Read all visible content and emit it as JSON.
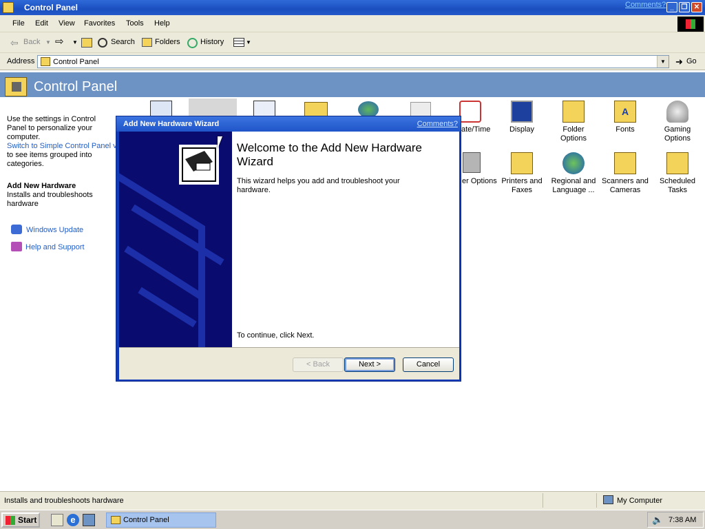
{
  "window": {
    "title": "Control Panel",
    "comments_link": "Comments?"
  },
  "menubar": {
    "items": [
      "File",
      "Edit",
      "View",
      "Favorites",
      "Tools",
      "Help"
    ]
  },
  "toolbar": {
    "back": "Back",
    "search": "Search",
    "folders": "Folders",
    "history": "History"
  },
  "address": {
    "label": "Address",
    "value": "Control Panel",
    "go": "Go"
  },
  "banner": {
    "title": "Control Panel"
  },
  "left_pane": {
    "intro": "Use the settings in Control Panel to personalize your computer.",
    "switch_link": "Switch to Simple Control Panel view",
    "switch_rest": "to see items grouped into categories.",
    "selected_title": "Add New Hardware",
    "selected_desc": "Installs and troubleshoots hardware",
    "links": [
      "Windows Update",
      "Help and Support"
    ]
  },
  "icons": [
    {
      "label": "Date/Time",
      "partial": "ate/Time",
      "icon": "clock-icon"
    },
    {
      "label": "Display",
      "icon": "monitor-icon"
    },
    {
      "label": "Folder Options",
      "icon": "folder-options-icon"
    },
    {
      "label": "Fonts",
      "icon": "fonts-folder-icon"
    },
    {
      "label": "Gaming Options",
      "icon": "joystick-icon"
    },
    {
      "label": "Power Options",
      "partial": "er Options",
      "icon": "power-icon"
    },
    {
      "label": "Printers and Faxes",
      "icon": "printer-icon"
    },
    {
      "label": "Regional and Language ...",
      "icon": "globe-icon"
    },
    {
      "label": "Scanners and Cameras",
      "icon": "camera-icon"
    },
    {
      "label": "Scheduled Tasks",
      "icon": "scheduled-tasks-icon"
    }
  ],
  "dialog": {
    "title": "Add New Hardware Wizard",
    "comments": "Comments?",
    "heading": "Welcome to the Add New Hardware Wizard",
    "body": "This wizard helps you add and troubleshoot your hardware.",
    "continue": "To continue, click Next.",
    "back": "< Back",
    "next": "Next >",
    "cancel": "Cancel"
  },
  "statusbar": {
    "text": "Installs and troubleshoots hardware",
    "zone": "My Computer"
  },
  "taskbar": {
    "start": "Start",
    "task": "Control Panel",
    "clock": "7:38 AM"
  }
}
